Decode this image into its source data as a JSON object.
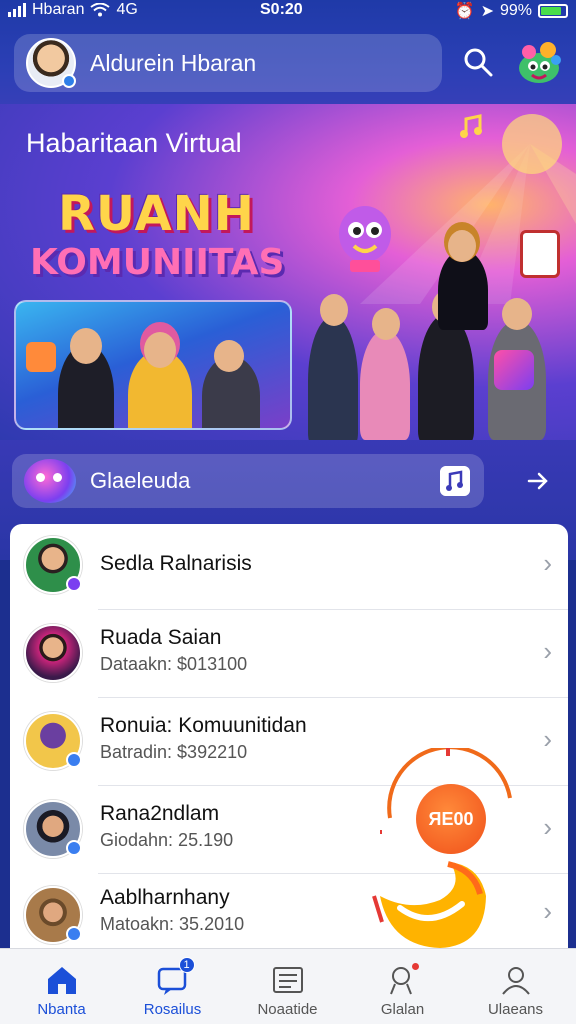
{
  "status_bar": {
    "carrier": "Hbaran",
    "network": "4G",
    "time": "S0:20",
    "battery": "99%"
  },
  "header": {
    "profile_name": "Aldurein Hbaran",
    "search_icon": "search-icon",
    "mascot_icon": "mascot-icon"
  },
  "banner": {
    "title": "Habaritaan Virtual",
    "logo_line_1": "RUANH",
    "logo_line_2": "KOMUNIITAS"
  },
  "groups_bar": {
    "label": "Glaeleuda"
  },
  "list": {
    "items": [
      {
        "title": "Sedla Ralnarisis",
        "subtitle": ""
      },
      {
        "title": "Ruada Saian",
        "subtitle": "Dataakn: $013100"
      },
      {
        "title": "Ronuia: Komuunitidan",
        "subtitle": "Batradin: $392210"
      },
      {
        "title": "Rana2ndlam",
        "subtitle": "Giodahn: 25.190"
      },
      {
        "title": "Aablharnhany",
        "subtitle": "Matoakn: 35.2010"
      }
    ]
  },
  "floating": {
    "coin_label": "ЯE00"
  },
  "bottom_nav": {
    "items": [
      {
        "label": "Nbanta",
        "icon": "home-icon",
        "active": true
      },
      {
        "label": "Rosailus",
        "icon": "chat-icon",
        "badge": "1"
      },
      {
        "label": "Noaatide",
        "icon": "news-icon"
      },
      {
        "label": "Glalan",
        "icon": "location-icon"
      },
      {
        "label": "Ulaeans",
        "icon": "profile-icon"
      }
    ]
  },
  "colors": {
    "primary": "#1b4fd8",
    "header_bg": "#2b3fb5",
    "accent_orange": "#f0501a"
  }
}
